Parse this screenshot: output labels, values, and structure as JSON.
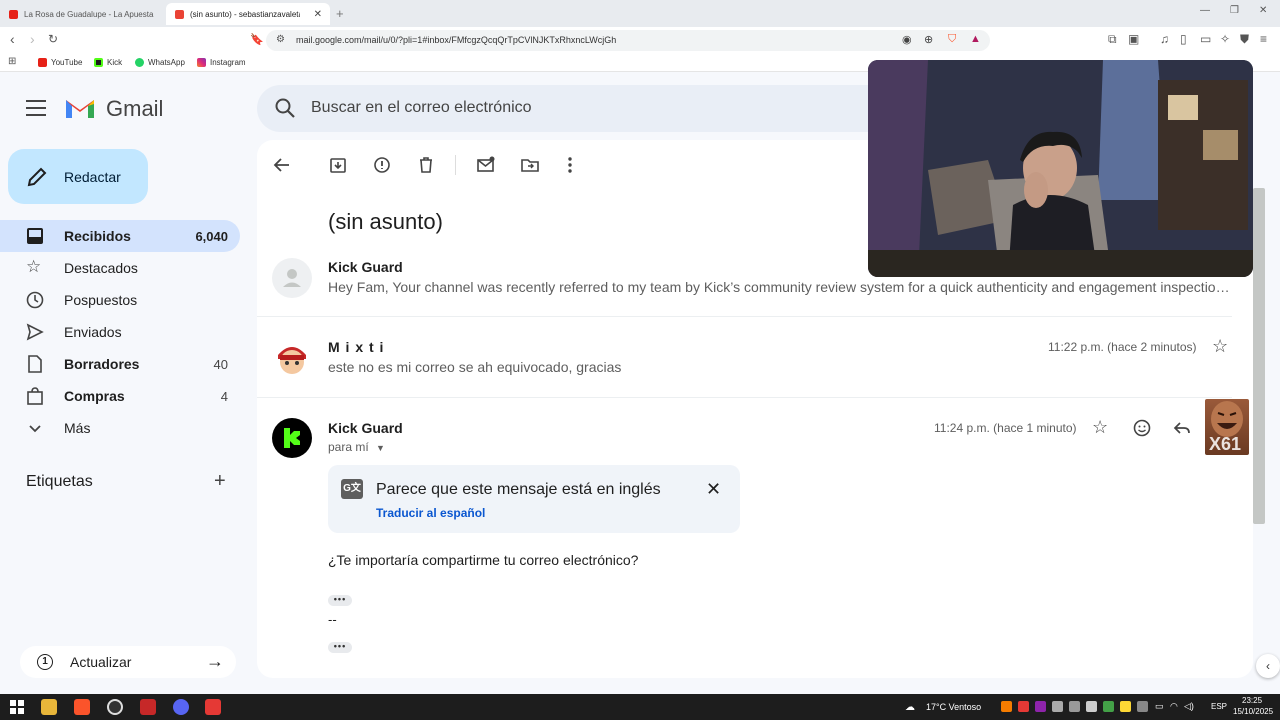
{
  "browser": {
    "tabs": [
      {
        "title": "La Rosa de Guadalupe - La Apuesta",
        "active": false
      },
      {
        "title": "(sin asunto) - sebastianzavaleta...",
        "active": true
      }
    ],
    "url": "mail.google.com/mail/u/0/?pli=1#inbox/FMfcgzQcqQrTpCVlNJKTxRhxncLWcjGh",
    "bookmarks": [
      "YouTube",
      "Kick",
      "WhatsApp",
      "Instagram"
    ]
  },
  "gmail": {
    "brand": "Gmail",
    "search_placeholder": "Buscar en el correo electrónico",
    "compose_label": "Redactar",
    "nav": [
      {
        "label": "Recibidos",
        "count": "6,040",
        "icon": "inbox-icon",
        "bold": true,
        "active": true
      },
      {
        "label": "Destacados",
        "count": "",
        "icon": "star-icon",
        "bold": false,
        "active": false
      },
      {
        "label": "Pospuestos",
        "count": "",
        "icon": "clock-icon",
        "bold": false,
        "active": false
      },
      {
        "label": "Enviados",
        "count": "",
        "icon": "send-icon",
        "bold": false,
        "active": false
      },
      {
        "label": "Borradores",
        "count": "40",
        "icon": "draft-icon",
        "bold": true,
        "active": false
      },
      {
        "label": "Compras",
        "count": "4",
        "icon": "shopping-bag-icon",
        "bold": true,
        "active": false
      },
      {
        "label": "Más",
        "count": "",
        "icon": "chevron-down-icon",
        "bold": false,
        "active": false
      }
    ],
    "labels_heading": "Etiquetas",
    "update_label": "Actualizar"
  },
  "thread": {
    "subject": "(sin asunto)",
    "messages": [
      {
        "sender": "Kick Guard",
        "snippet": "Hey Fam, Your channel was recently referred to my team by Kick’s community review system for a quick authenticity and engagement inspection — part of...",
        "time": ""
      },
      {
        "sender": "M i x t i",
        "snippet": "este no es mi correo se ah equivocado, gracias",
        "time": "11:22 p.m. (hace 2 minutos)"
      },
      {
        "sender": "Kick Guard",
        "recipient": "para mí",
        "time": "11:24 p.m. (hace 1 minuto)",
        "translate_title": "Parece que este mensaje está en inglés",
        "translate_link": "Traducir al español",
        "body": "¿Te importaría compartirme tu correo electrónico?",
        "signature": "--"
      }
    ]
  },
  "overlay": {
    "emote_count": "X61"
  },
  "taskbar": {
    "weather": "17°C Ventoso",
    "lang": "ESP",
    "time": "23:25",
    "date": "15/10/2025"
  },
  "colors": {
    "accent": "#0b57d0",
    "compose_bg": "#c2e7ff",
    "active_nav": "#d3e3fd",
    "kick_green": "#53fc18"
  }
}
